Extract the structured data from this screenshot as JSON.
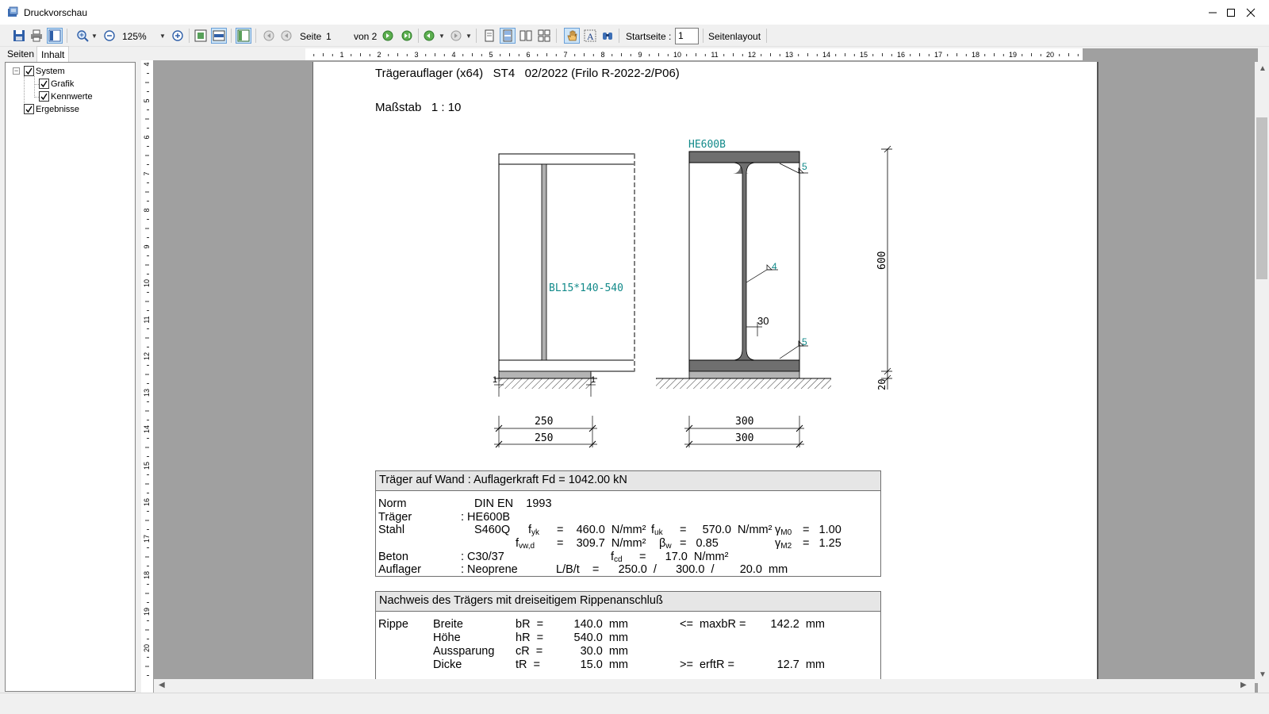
{
  "window": {
    "title": "Druckvorschau",
    "icon": "print-preview-app-icon",
    "controls": [
      "minimize-icon",
      "maximize-icon",
      "close-icon"
    ]
  },
  "toolbar": {
    "zoom_value": "125%",
    "page_label": "Seite",
    "page_value": "1",
    "page_total": "von 2",
    "start_page_label": "Startseite :",
    "start_page_value": "1",
    "layout_label": "Seitenlayout",
    "icons": [
      "save-icon",
      "print-icon",
      "thumbnail-toggle-icon",
      "zoom-in-icon",
      "zoom-out-icon",
      "zoom-plus-icon",
      "fit-page-icon",
      "fit-width-icon",
      "outline-icon",
      "first-page-icon",
      "previous-page-icon",
      "next-page-icon",
      "last-page-icon",
      "go-forward-icon",
      "go-back-icon",
      "single-page-icon",
      "single-continuous-icon",
      "two-pages-icon",
      "multi-page-icon",
      "hand-tool-icon",
      "text-select-icon",
      "find-icon"
    ]
  },
  "tabs": [
    "Seiten",
    "Inhalt"
  ],
  "active_tab": "Inhalt",
  "tree": {
    "root": "System",
    "children": [
      "Grafik",
      "Kennwerte"
    ],
    "sibling": "Ergebnisse"
  },
  "rulers": {
    "horizontal": [
      "1",
      "2",
      "3",
      "4",
      "5",
      "6",
      "7",
      "8",
      "9",
      "10",
      "11",
      "12",
      "13",
      "14",
      "15",
      "16",
      "17",
      "18",
      "19",
      "20"
    ],
    "vertical": [
      "4",
      "5",
      "6",
      "7",
      "8",
      "9",
      "10",
      "11",
      "12",
      "13",
      "14",
      "15",
      "16",
      "17",
      "18",
      "19",
      "20"
    ]
  },
  "document": {
    "heading": "Trägerauflager (x64)   ST4   02/2022 (Frilo R-2022-2/P06)",
    "scale": "Maßstab   1 : 10",
    "drawing": {
      "section_label": "HE600B",
      "plate_label": "BL15*140-540",
      "weld_top": "5",
      "weld_web": "4",
      "weld_bottom": "5",
      "cutout": "30",
      "height": "600",
      "bearing_thickness": "20",
      "mark_left": "1",
      "mark_right": "1",
      "dim_left_1": "250",
      "dim_left_2": "250",
      "dim_right_1": "300",
      "dim_right_2": "300"
    },
    "box1": {
      "title": "Träger auf Wand : Auflagerkraft Fd = 1042.00 kN",
      "norm_label": "Norm",
      "norm_value": "DIN EN    1993",
      "traeger_label": "Träger",
      "traeger_value": ": HE600B",
      "stahl_label": "Stahl",
      "stahl_value": "S460Q",
      "fyk_eq": "=    460.0  N/mm²",
      "fuk_eq": "=     570.0  N/mm²",
      "gm0_eq": "=   1.00",
      "fvwd_eq": "=    309.7  N/mm²",
      "bw_eq": "=   0.85",
      "gm2_eq": "=   1.25",
      "beton_label": "Beton",
      "beton_value": ": C30/37",
      "fcd_eq": "=      17.0  N/mm²",
      "auflager_label": "Auflager",
      "auflager_value": ": Neoprene",
      "auflager_dims": "L/B/t    =      250.0  /      300.0  /        20.0  mm"
    },
    "box2": {
      "title": "Nachweis des Trägers mit dreiseitigem Rippenanschluß",
      "rippe_label": "Rippe",
      "rows": [
        {
          "name": "Breite",
          "sym": "bR  =",
          "val": "140.0  mm",
          "cmp": "<=  maxbR =",
          "lim": "142.2  mm"
        },
        {
          "name": "Höhe",
          "sym": "hR  =",
          "val": "540.0  mm",
          "cmp": "",
          "lim": ""
        },
        {
          "name": "Aussparung",
          "sym": "cR  =",
          "val": "30.0  mm",
          "cmp": "",
          "lim": ""
        },
        {
          "name": "Dicke",
          "sym": "tR  =",
          "val": "15.0  mm",
          "cmp": ">=  erftR =",
          "lim": "12.7  mm"
        }
      ]
    }
  }
}
